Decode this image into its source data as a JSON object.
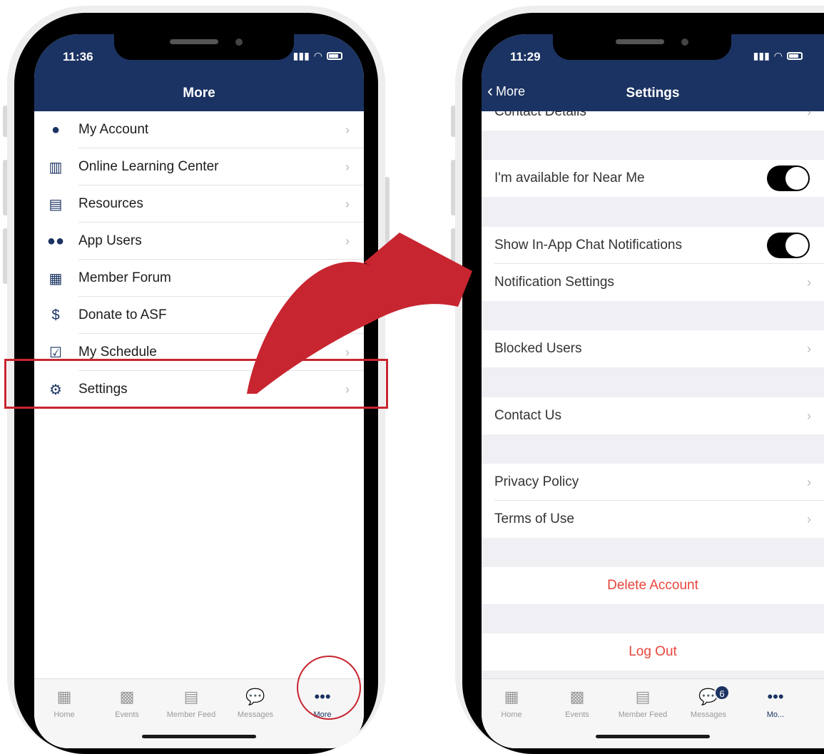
{
  "left_screen": {
    "status_time": "11:36",
    "title": "More",
    "menu_items": [
      {
        "label": "My Account",
        "icon": "account-icon"
      },
      {
        "label": "Online Learning Center",
        "icon": "book-icon"
      },
      {
        "label": "Resources",
        "icon": "archive-icon"
      },
      {
        "label": "App Users",
        "icon": "users-icon"
      },
      {
        "label": "Member Forum",
        "icon": "forum-icon"
      },
      {
        "label": "Donate to ASF",
        "icon": "dollar-icon"
      },
      {
        "label": "My Schedule",
        "icon": "calendar-check-icon"
      },
      {
        "label": "Settings",
        "icon": "gear-icon"
      }
    ],
    "tabs": [
      {
        "label": "Home"
      },
      {
        "label": "Events"
      },
      {
        "label": "Member Feed"
      },
      {
        "label": "Messages"
      },
      {
        "label": "More"
      }
    ]
  },
  "right_screen": {
    "status_time": "11:29",
    "back_label": "More",
    "title": "Settings",
    "partial_row": "Contact Details",
    "rows": {
      "near_me": "I'm available for Near Me",
      "chat_notifications": "Show In-App Chat Notifications",
      "notification_settings": "Notification Settings",
      "blocked_users": "Blocked Users",
      "contact_us": "Contact Us",
      "privacy_policy": "Privacy Policy",
      "terms_of_use": "Terms of Use",
      "delete_account": "Delete Account",
      "log_out": "Log Out"
    },
    "toggles": {
      "near_me": true,
      "chat_notifications": true
    },
    "tabs": [
      {
        "label": "Home"
      },
      {
        "label": "Events"
      },
      {
        "label": "Member Feed"
      },
      {
        "label": "Messages",
        "badge": "6"
      },
      {
        "label": "Mo..."
      }
    ]
  },
  "colors": {
    "navbar": "#1b3362",
    "highlight": "#c72530",
    "destructive": "#e8453c"
  }
}
